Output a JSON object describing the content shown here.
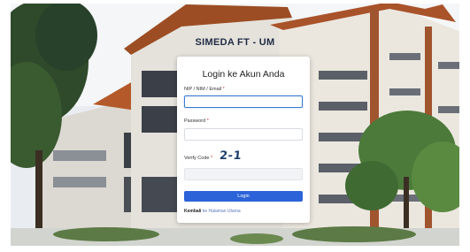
{
  "site": {
    "brand": "SIMEDA FT - UM"
  },
  "login": {
    "title": "Login ke Akun Anda",
    "nip_label": "NIP / NIM / Email",
    "nip_value": "",
    "password_label": "Password",
    "password_value": "",
    "verify_label": "Verify Code",
    "verify_captcha": "2-1",
    "verify_value": "",
    "required_mark": "*",
    "submit_label": "Login",
    "back_prefix": "Kembali",
    "back_link": "ke Halaman Utama"
  },
  "colors": {
    "accent": "#2c63d8",
    "focus_border": "#3a7bd5",
    "captcha": "#1d3d6b",
    "required": "#dd3333"
  }
}
